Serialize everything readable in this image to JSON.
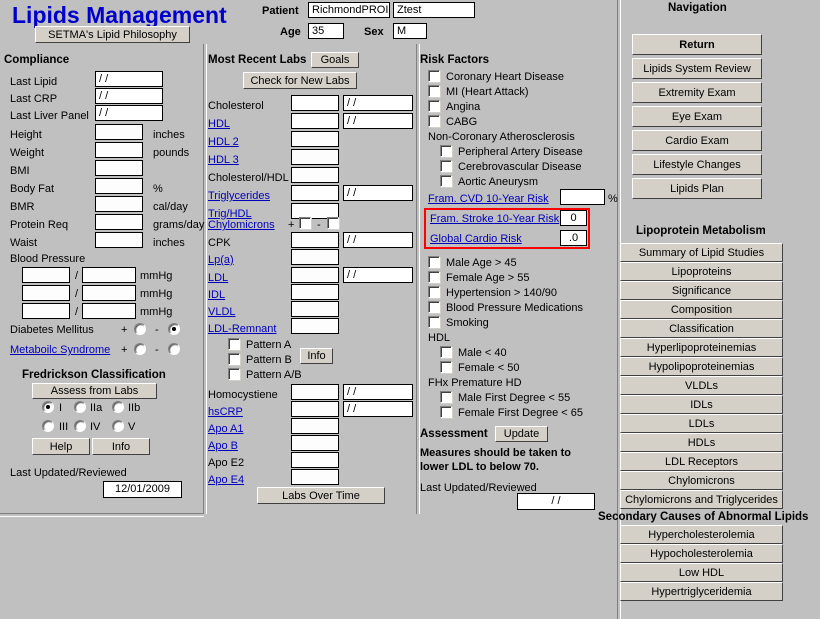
{
  "app": {
    "title": "Lipids Management",
    "philosophy_button": "SETMA's Lipid Philosophy"
  },
  "patient": {
    "label_patient": "Patient",
    "name_last": "RichmondPROI",
    "name_first": "Ztest",
    "label_age": "Age",
    "age": "35",
    "label_sex": "Sex",
    "sex": "M"
  },
  "compliance": {
    "heading": "Compliance",
    "rows": [
      {
        "label": "Last Lipid",
        "value": "/  /"
      },
      {
        "label": "Last CRP",
        "value": "/  /"
      },
      {
        "label": "Last Liver Panel",
        "value": "/  /"
      }
    ],
    "measures": [
      {
        "label": "Height",
        "value": "",
        "unit": "inches"
      },
      {
        "label": "Weight",
        "value": "",
        "unit": "pounds"
      },
      {
        "label": "BMI",
        "value": "",
        "unit": ""
      },
      {
        "label": "Body Fat",
        "value": "",
        "unit": "%"
      },
      {
        "label": "BMR",
        "value": "",
        "unit": "cal/day"
      },
      {
        "label": "Protein Req",
        "value": "",
        "unit": "grams/day"
      },
      {
        "label": "Waist",
        "value": "",
        "unit": "inches"
      }
    ],
    "blood_pressure": {
      "label": "Blood Pressure",
      "unit": "mmHg",
      "separator": "/",
      "rows": [
        {
          "systolic": "",
          "diastolic": ""
        },
        {
          "systolic": "",
          "diastolic": ""
        },
        {
          "systolic": "",
          "diastolic": ""
        }
      ]
    },
    "diabetes": {
      "label": "Diabetes Mellitus",
      "plus": "+",
      "minus": "-",
      "selected": "minus"
    },
    "metabolic_syndrome": {
      "label": "Metaboilc Syndrome",
      "plus": "+",
      "minus": "-",
      "selected": "none"
    },
    "fredrickson": {
      "heading": "Fredrickson Classification",
      "assess_button": "Assess from Labs",
      "options": [
        "I",
        "IIa",
        "IIb",
        "III",
        "IV",
        "V"
      ],
      "selected": "I",
      "help_button": "Help",
      "info_button": "Info"
    },
    "last_updated_label": "Last Updated/Reviewed",
    "last_updated_value": "12/01/2009"
  },
  "labs": {
    "heading": "Most Recent Labs",
    "goals_button": "Goals",
    "check_button": "Check for New Labs",
    "rows": [
      {
        "label": "Cholesterol",
        "link": false,
        "value": "",
        "date": "/  /"
      },
      {
        "label": "HDL",
        "link": true,
        "value": "",
        "date": "/  /"
      },
      {
        "label": "HDL 2",
        "link": true,
        "value": "",
        "date": null
      },
      {
        "label": "HDL 3",
        "link": true,
        "value": "",
        "date": null
      },
      {
        "label": "Cholesterol/HDL",
        "link": false,
        "value": "",
        "date": null
      },
      {
        "label": "Triglycerides",
        "link": true,
        "value": "",
        "date": "/  /"
      },
      {
        "label": "Trig/HDL",
        "link": true,
        "value": "",
        "date": null
      }
    ],
    "chylomicrons": {
      "label": "Chylomicrons",
      "plus": "+",
      "minus": "-"
    },
    "rows2": [
      {
        "label": "CPK",
        "link": false,
        "value": "",
        "date": "/  /"
      },
      {
        "label": "Lp(a)",
        "link": true,
        "value": "",
        "date": null
      },
      {
        "label": "LDL",
        "link": true,
        "value": "",
        "date": "/  /"
      },
      {
        "label": "IDL",
        "link": true,
        "value": "",
        "date": null
      },
      {
        "label": "VLDL",
        "link": true,
        "value": "",
        "date": null
      },
      {
        "label": "LDL-Remnant",
        "link": true,
        "value": "",
        "date": null
      }
    ],
    "patterns": [
      {
        "label": "Pattern A"
      },
      {
        "label": "Pattern B"
      },
      {
        "label": "Pattern A/B"
      }
    ],
    "pattern_info_button": "Info",
    "rows3": [
      {
        "label": "Homocystiene",
        "link": false,
        "value": "",
        "date": "/  /"
      },
      {
        "label": "hsCRP",
        "link": true,
        "value": "",
        "date": "/  /"
      },
      {
        "label": "Apo A1",
        "link": true,
        "value": "",
        "date": null
      },
      {
        "label": "Apo B",
        "link": true,
        "value": "",
        "date": null
      },
      {
        "label": "Apo E2",
        "link": false,
        "value": "",
        "date": null
      },
      {
        "label": "Apo E4",
        "link": true,
        "value": "",
        "date": null
      }
    ],
    "labs_over_time_button": "Labs Over Time"
  },
  "risk_factors": {
    "heading": "Risk Factors",
    "primary": [
      "Coronary Heart Disease",
      "MI (Heart Attack)",
      "Angina",
      "CABG"
    ],
    "non_coronary_label": "Non-Coronary Atherosclerosis",
    "non_coronary": [
      "Peripheral Artery Disease",
      "Cerebrovascular Disease",
      "Aortic Aneurysm"
    ],
    "scores": [
      {
        "label": "Fram. CVD 10-Year Risk",
        "value": "",
        "suffix": "%",
        "highlighted": false
      },
      {
        "label": "Fram. Stroke 10-Year Risk",
        "value": "0",
        "suffix": "",
        "highlighted": true
      },
      {
        "label": "Global Cardio Risk",
        "value": ".0",
        "suffix": "",
        "highlighted": true
      }
    ],
    "secondary": [
      "Male Age > 45",
      "Female Age > 55",
      "Hypertension > 140/90",
      "Blood Pressure Medications",
      "Smoking"
    ],
    "hdl_label": "HDL",
    "hdl_items": [
      "Male < 40",
      "Female < 50"
    ],
    "fhx_label": "FHx Premature HD",
    "fhx_items": [
      "Male First Degree < 55",
      "Female First Degree < 65"
    ],
    "assessment_label": "Assessment",
    "update_button": "Update",
    "assessment_text_line1": "Measures should be taken to",
    "assessment_text_line2": "lower LDL to below 70.",
    "last_updated_label": "Last Updated/Reviewed",
    "last_updated_value": "/  /"
  },
  "navigation": {
    "heading": "Navigation",
    "buttons": [
      {
        "label": "Return",
        "bold": true
      },
      {
        "label": "Lipids System Review",
        "bold": false
      },
      {
        "label": "Extremity Exam",
        "bold": false
      },
      {
        "label": "Eye Exam",
        "bold": false
      },
      {
        "label": "Cardio Exam",
        "bold": false
      },
      {
        "label": "Lifestyle Changes",
        "bold": false
      },
      {
        "label": "Lipids Plan",
        "bold": false
      }
    ]
  },
  "lipoprotein_metabolism": {
    "heading": "Lipoprotein Metabolism",
    "buttons": [
      "Summary of Lipid Studies",
      "Lipoproteins",
      "Significance",
      "Composition",
      "Classification",
      "Hyperlipoproteinemias",
      "Hypolipoproteinemias",
      "VLDLs",
      "IDLs",
      "LDLs",
      "HDLs",
      "LDL Receptors",
      "Chylomicrons",
      "Chylomicrons and Triglycerides"
    ]
  },
  "secondary_causes": {
    "heading": "Secondary Causes of Abnormal Lipids",
    "buttons": [
      "Hypercholesterolemia",
      "Hypocholesterolemia",
      "Low HDL",
      "Hypertriglyceridemia"
    ]
  },
  "colors": {
    "background": "#c0c0c0",
    "title": "#0000cc",
    "link": "#0000bb",
    "highlight": "#ff0000",
    "button_face": "#d4d0c8"
  }
}
